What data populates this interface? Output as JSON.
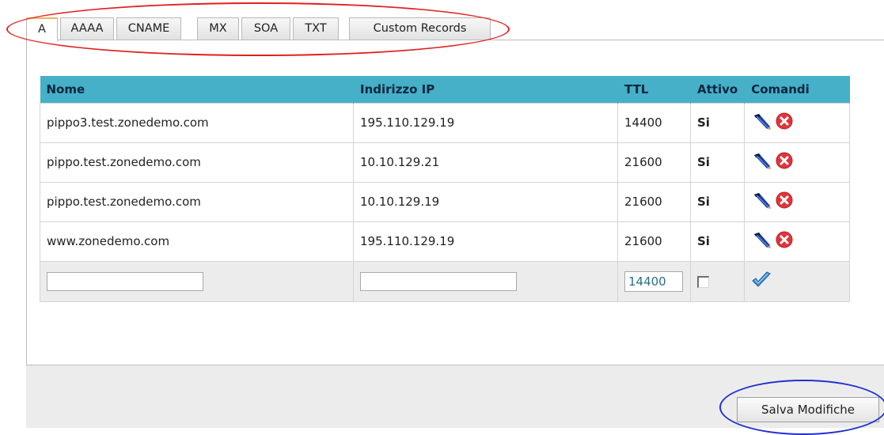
{
  "tabs": [
    {
      "label": "A",
      "active": true
    },
    {
      "label": "AAAA"
    },
    {
      "label": "CNAME"
    },
    {
      "label": "MX"
    },
    {
      "label": "SOA"
    },
    {
      "label": "TXT"
    },
    {
      "label": "Custom Records"
    }
  ],
  "table": {
    "headers": [
      "Nome",
      "Indirizzo IP",
      "TTL",
      "Attivo",
      "Comandi"
    ],
    "rows": [
      {
        "nome": "pippo3.test.zonedemo.com",
        "ip": "195.110.129.19",
        "ttl": "14400",
        "attivo": "Si"
      },
      {
        "nome": "pippo.test.zonedemo.com",
        "ip": "10.10.129.21",
        "ttl": "21600",
        "attivo": "Si"
      },
      {
        "nome": "pippo.test.zonedemo.com",
        "ip": "10.10.129.19",
        "ttl": "21600",
        "attivo": "Si"
      },
      {
        "nome": "www.zonedemo.com",
        "ip": "195.110.129.19",
        "ttl": "21600",
        "attivo": "Si"
      }
    ],
    "new_row": {
      "nome_value": "",
      "ip_value": "",
      "ttl_value": "14400",
      "attivo_checked": false
    }
  },
  "icons": {
    "edit": "pencil-icon",
    "delete": "delete-icon",
    "confirm": "checkmark-icon"
  },
  "colors": {
    "header_bg": "#45b0c7",
    "active_green": "#1e8a1e",
    "delete_red": "#e0353b",
    "highlight_red": "#e02020",
    "highlight_blue": "#2030d0"
  },
  "save_label": "Salva Modifiche"
}
